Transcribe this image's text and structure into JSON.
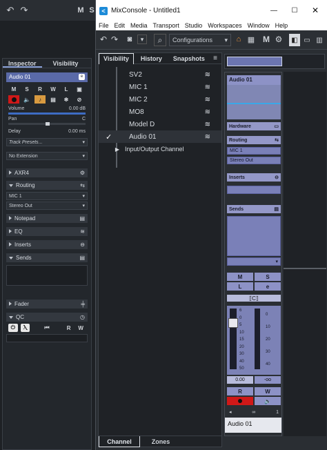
{
  "background": {
    "buttons": {
      "undo": "↶",
      "redo": "↷",
      "m": "M",
      "s": "S"
    }
  },
  "inspector": {
    "tabs": [
      "Inspector",
      "Visibility"
    ],
    "track_name": "Audio 01",
    "track_buttons": [
      "M",
      "S",
      "R",
      "W",
      "L"
    ],
    "volume_label": "Volume",
    "volume_value": "0.00 dB",
    "pan_label": "Pan",
    "pan_value": "C",
    "delay_label": "Delay",
    "delay_value": "0.00 ms",
    "track_presets": "Track Presets...",
    "extension": "No Extension",
    "sections": {
      "axr4": "AXR4",
      "routing": "Routing",
      "notepad": "Notepad",
      "eq": "EQ",
      "inserts": "Inserts",
      "sends": "Sends",
      "fader": "Fader",
      "qc": "QC"
    },
    "routing_in": "MIC 1",
    "routing_out": "Stereo Out",
    "qc_r": "R",
    "qc_w": "W"
  },
  "mix": {
    "title": "MixConsole - Untitled1",
    "menu": [
      "File",
      "Edit",
      "Media",
      "Transport",
      "Studio",
      "Workspaces",
      "Window",
      "Help"
    ],
    "configurations": "Configurations",
    "toolbar_m": "M",
    "tabs": [
      "Visibility",
      "History",
      "Snapshots"
    ],
    "bottom_tabs": [
      "Channel",
      "Zones"
    ],
    "channels": [
      {
        "name": "SV2",
        "checked": false
      },
      {
        "name": "MIC 1",
        "checked": false
      },
      {
        "name": "MIC 2",
        "checked": false
      },
      {
        "name": "MO8",
        "checked": false
      },
      {
        "name": "Model D",
        "checked": false
      },
      {
        "name": "Audio 01",
        "checked": true
      }
    ],
    "io_channel": "Input/Output Channel",
    "check_mark": "✓",
    "strip": {
      "name": "Audio 01",
      "hardware": "Hardware",
      "routing": "Routing",
      "routing_in": "MIC 1",
      "routing_out": "Stereo Out",
      "inserts": "Inserts",
      "sends": "Sends",
      "m": "M",
      "s": "S",
      "l": "L",
      "e": "e",
      "fader_value": "0.00",
      "pan_value": "-oo",
      "r": "R",
      "w": "W",
      "scale": [
        "6",
        "0",
        "5",
        "10",
        "15",
        "20",
        "30",
        "40",
        "50"
      ],
      "meter_scale": [
        "0",
        "10",
        "20",
        "30",
        "40"
      ],
      "footer_num": "1"
    }
  },
  "colors": {
    "accent": "#5a6aa8",
    "strip_section": "#9498c8",
    "record": "#d01818",
    "monitor": "#d89a40"
  }
}
